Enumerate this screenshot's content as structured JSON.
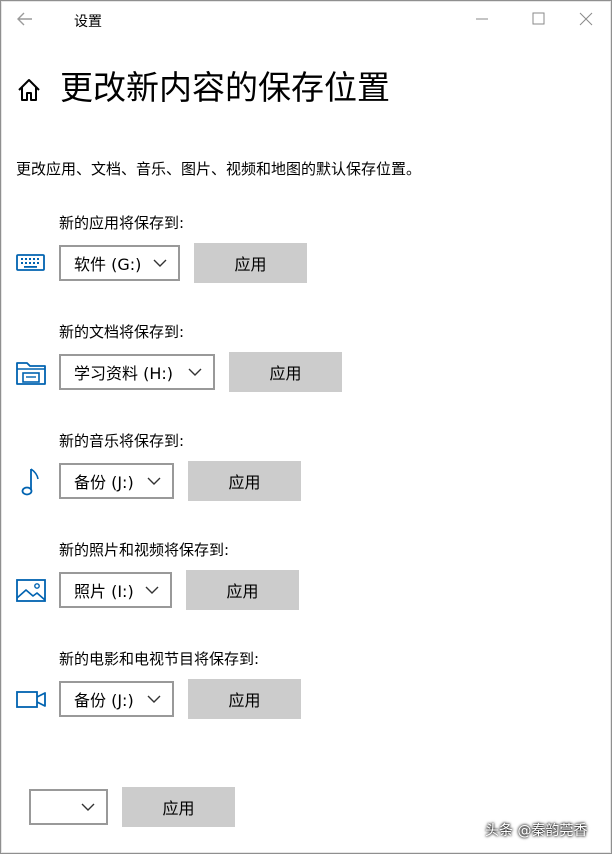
{
  "window": {
    "title": "设置"
  },
  "header": {
    "page_title": "更改新内容的保存位置",
    "description": "更改应用、文档、音乐、图片、视频和地图的默认保存位置。"
  },
  "sections": [
    {
      "label": "新的应用将保存到:",
      "icon": "keyboard-icon",
      "drive": "软件 (G:)",
      "button": "应用"
    },
    {
      "label": "新的文档将保存到:",
      "icon": "folder-icon",
      "drive": "学习资料 (H:)",
      "button": "应用"
    },
    {
      "label": "新的音乐将保存到:",
      "icon": "music-note-icon",
      "drive": "备份 (J:)",
      "button": "应用"
    },
    {
      "label": "新的照片和视频将保存到:",
      "icon": "picture-icon",
      "drive": "照片 (I:)",
      "button": "应用"
    },
    {
      "label": "新的电影和电视节目将保存到:",
      "icon": "video-camera-icon",
      "drive": "备份 (J:)",
      "button": "应用"
    }
  ],
  "maps": {
    "drive": "",
    "button": "应用"
  },
  "watermark": "头条 @秦韵莞香",
  "colors": {
    "accent": "#0063b1",
    "button_bg": "#cccccc",
    "border": "#999999"
  }
}
